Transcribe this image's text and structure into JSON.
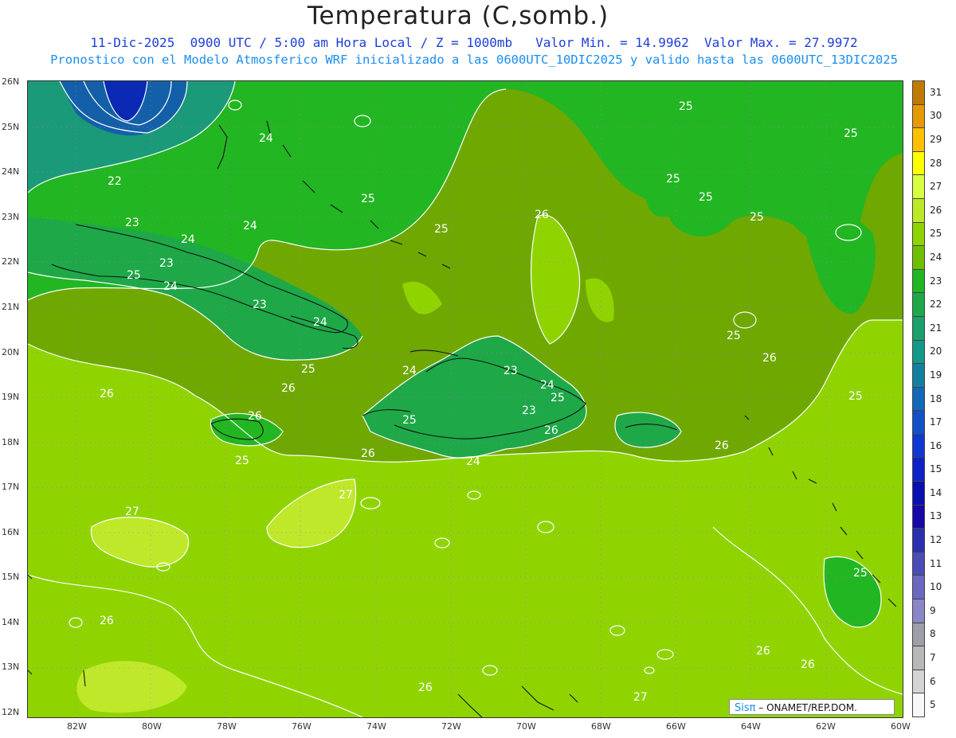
{
  "title": "Temperatura (C,somb.)",
  "subtitle_line1": "11-Dic-2025  0900 UTC / 5:00 am Hora Local / Z = 1000mb   Valor Min. = 14.9962  Valor Max. = 27.9972",
  "subtitle_line2": "Pronostico con el Modelo Atmosferico WRF inicializado a las 0600UTC_10DIC2025 y valido hasta las  0600UTC_13DIC2025",
  "logo": {
    "sis": "Sisπ",
    "text": " – ONAMET/REP.DOM."
  },
  "axes": {
    "lat_labels": [
      "26N",
      "25N",
      "24N",
      "23N",
      "22N",
      "21N",
      "20N",
      "19N",
      "18N",
      "17N",
      "16N",
      "15N",
      "14N",
      "13N",
      "12N"
    ],
    "lon_labels": [
      "82W",
      "80W",
      "78W",
      "76W",
      "74W",
      "72W",
      "70W",
      "68W",
      "66W",
      "64W",
      "62W",
      "60W"
    ]
  },
  "colorbar": {
    "levels": [
      "31",
      "30",
      "29",
      "28",
      "27",
      "26",
      "25",
      "24",
      "23",
      "22",
      "21",
      "20",
      "19",
      "18",
      "17",
      "16",
      "15",
      "14",
      "13",
      "12",
      "11",
      "10",
      "9",
      "8",
      "7",
      "6",
      "5"
    ],
    "colors": [
      "#c07a00",
      "#e69a00",
      "#ffc000",
      "#ffff00",
      "#d8ff40",
      "#bde827",
      "#8fd400",
      "#6fbe00",
      "#22b622",
      "#1ea848",
      "#1aa06a",
      "#14988a",
      "#1480a0",
      "#1468b8",
      "#1250c8",
      "#1036d4",
      "#0e22c8",
      "#0a10b0",
      "#1808a8",
      "#2a30b0",
      "#4a4cb8",
      "#6a68c0",
      "#8a86c8",
      "#9e9ea8",
      "#b8b8b8",
      "#d4d4d4",
      "#f8f8f8"
    ]
  },
  "map": {
    "contour_labels": [
      "22",
      "23",
      "23",
      "23",
      "23",
      "23",
      "24",
      "24",
      "24",
      "24",
      "24",
      "24",
      "24",
      "24",
      "25",
      "25",
      "25",
      "25",
      "25",
      "25",
      "25",
      "25",
      "25",
      "25",
      "25",
      "25",
      "25",
      "25",
      "25",
      "26",
      "26",
      "26",
      "26",
      "26",
      "26",
      "26",
      "26",
      "26",
      "26",
      "26",
      "26",
      "27",
      "27",
      "27"
    ],
    "colors": {
      "t22": "#1a9a78",
      "t23": "#1ea848",
      "t24": "#22b622",
      "t25": "#6fa800",
      "t26": "#8fd400",
      "t27": "#bfe82a",
      "cold": "#0a2ab4",
      "cold2": "#1460a8"
    }
  }
}
